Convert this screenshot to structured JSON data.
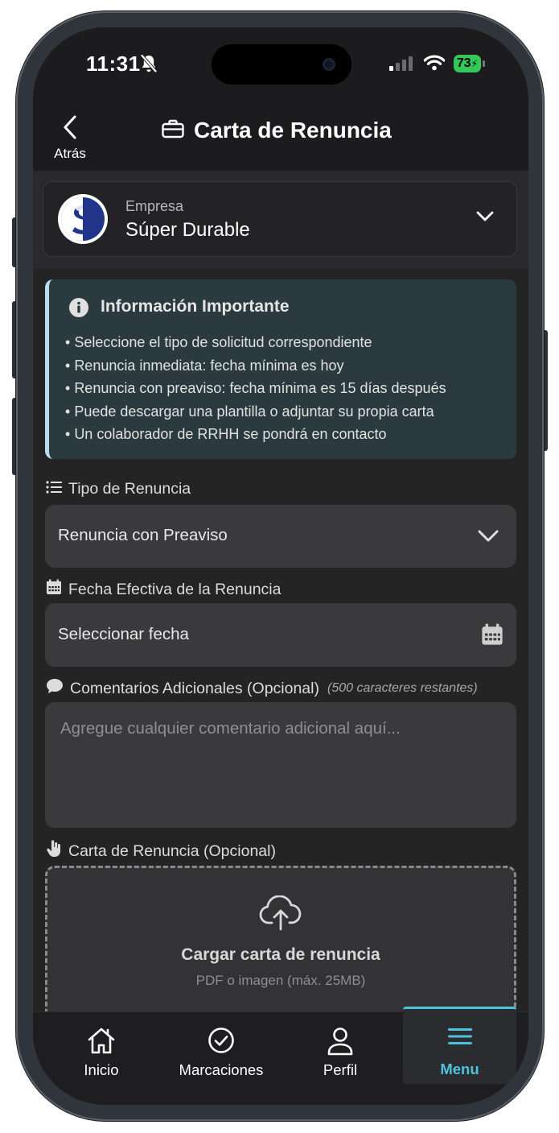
{
  "status_bar": {
    "time": "11:31",
    "battery": "73"
  },
  "header": {
    "back_label": "Atrás",
    "title": "Carta de Renuncia"
  },
  "company": {
    "label": "Empresa",
    "name": "Súper Durable"
  },
  "info": {
    "title": "Información Importante",
    "items": [
      "Seleccione el tipo de solicitud correspondiente",
      "Renuncia inmediata: fecha mínima es hoy",
      "Renuncia con preaviso: fecha mínima es 15 días después",
      "Puede descargar una plantilla o adjuntar su propia carta",
      "Un colaborador de RRHH se pondrá en contacto"
    ]
  },
  "form": {
    "type_label": "Tipo de Renuncia",
    "type_value": "Renuncia con Preaviso",
    "date_label": "Fecha Efectiva de la Renuncia",
    "date_placeholder": "Seleccionar fecha",
    "comments_label": "Comentarios Adicionales (Opcional)",
    "comments_hint": "(500 caracteres restantes)",
    "comments_placeholder": "Agregue cualquier comentario adicional aquí...",
    "letter_label": "Carta de Renuncia (Opcional)",
    "upload_title": "Cargar carta de renuncia",
    "upload_subtitle": "PDF o imagen (máx. 25MB)"
  },
  "tabs": [
    {
      "label": "Inicio",
      "icon": "home-icon"
    },
    {
      "label": "Marcaciones",
      "icon": "check-circle-icon"
    },
    {
      "label": "Perfil",
      "icon": "person-icon"
    },
    {
      "label": "Menu",
      "icon": "menu-icon",
      "active": true
    }
  ],
  "colors": {
    "accent": "#4fc3dd",
    "info_bg": "#2b3a3e",
    "info_border": "#b9dcf0",
    "battery": "#34c759"
  }
}
